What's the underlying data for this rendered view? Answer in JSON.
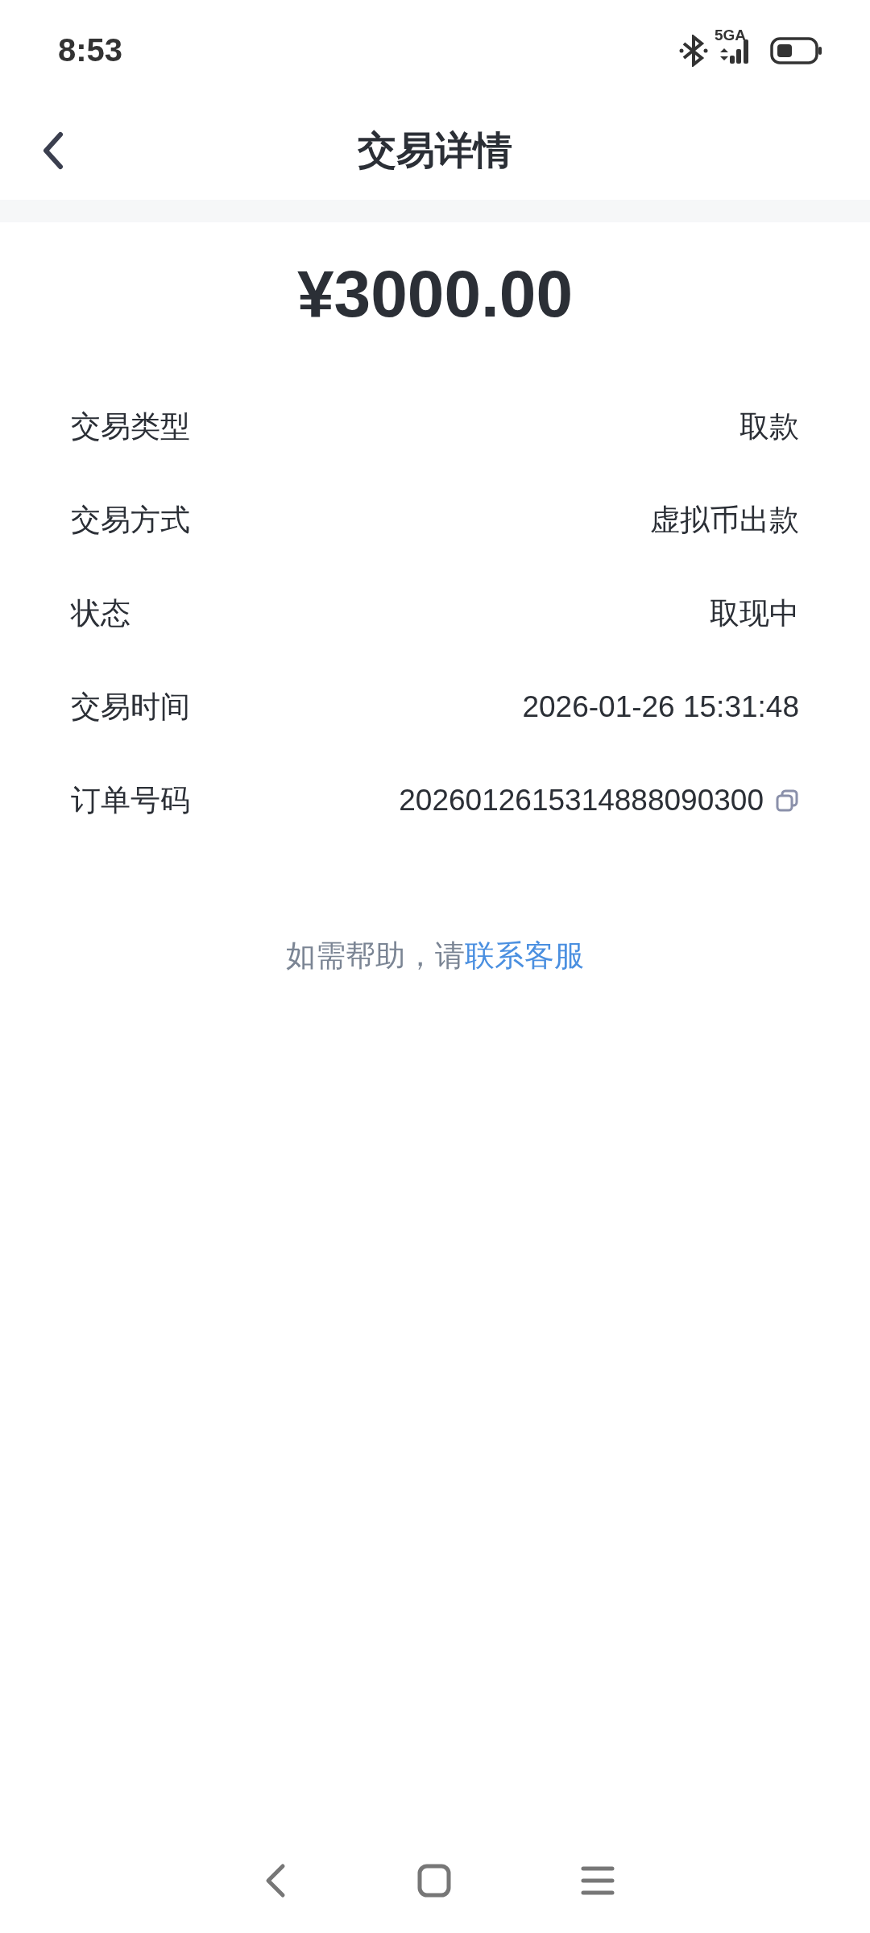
{
  "status_bar": {
    "time": "8:53",
    "network": "5GA"
  },
  "header": {
    "title": "交易详情"
  },
  "amount": "¥3000.00",
  "details": [
    {
      "label": "交易类型",
      "value": "取款",
      "copyable": false
    },
    {
      "label": "交易方式",
      "value": "虚拟币出款",
      "copyable": false
    },
    {
      "label": "状态",
      "value": "取现中",
      "copyable": false
    },
    {
      "label": "交易时间",
      "value": "2026-01-26 15:31:48",
      "copyable": false
    },
    {
      "label": "订单号码",
      "value": "2026012615314888090300",
      "copyable": true
    }
  ],
  "help": {
    "text": "如需帮助，请",
    "link": "联系客服"
  }
}
